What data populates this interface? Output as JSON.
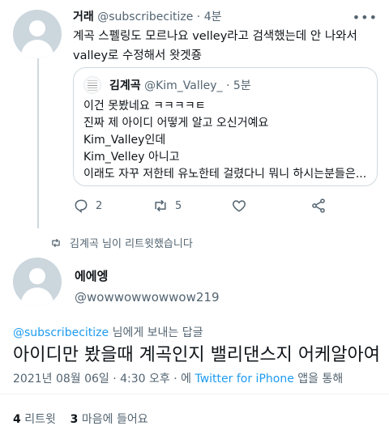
{
  "tweet1": {
    "name": "거래",
    "handle": "@subscribecitize",
    "separator": "·",
    "time": "4분",
    "text_line1": "계곡 스펠링도 모르나요 velley라고 검색했는데 안 나와서",
    "text_line2": "valley로 수정해서 왓겟죵",
    "quote": {
      "name": "김계곡",
      "handle": "@Kim_Valley_",
      "separator": "·",
      "time": "5분",
      "lines": [
        "이건 못봤네요 ㅋㅋㅋㅋㅌ",
        "진짜 제 아이디 어떻게 알고 오신거예요",
        "Kim_Valley인데",
        "Kim_Velley 아니고",
        "이래도 자꾸 저한테 유노한테 걸렸다니 뭐니 하시는분들은..."
      ]
    },
    "actions": {
      "reply_count": "2",
      "retweet_count": "5"
    }
  },
  "retweet_notice": "김계곡 님이 리트윗했습니다",
  "tweet2": {
    "name": "에에엥",
    "handle": "@wowwowwowwow219",
    "replying_to_handle": "@subscribecitize",
    "replying_to_suffix": " 님에게 보내는 답글",
    "text": "아이디만 봤을때 계곡인지 밸리댄스지 어케알아여",
    "timestamp": "2021년 08월 06일 · 4:30 오후 · 에 ",
    "client": "Twitter for iPhone",
    "client_suffix": " 앱을 통해",
    "retweets_count": "4",
    "retweets_label": " 리트윗",
    "likes_count": "3",
    "likes_label": " 마음에 들어요"
  }
}
